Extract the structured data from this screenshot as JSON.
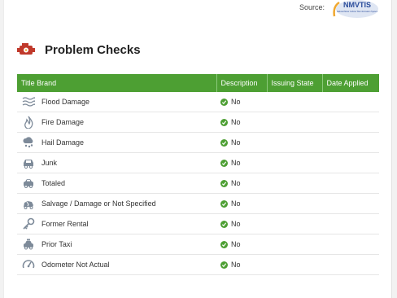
{
  "source": {
    "label": "Source:",
    "logo_text": "NMVTIS",
    "logo_subtext": "National Motor Vehicle Title Information System"
  },
  "section": {
    "title": "Problem Checks"
  },
  "table": {
    "headers": [
      "Title Brand",
      "Description",
      "Issuing State",
      "Date Applied"
    ],
    "rows": [
      {
        "brand": "Flood Damage",
        "icon": "flood-icon",
        "description": "No",
        "issuing_state": "",
        "date_applied": ""
      },
      {
        "brand": "Fire Damage",
        "icon": "fire-icon",
        "description": "No",
        "issuing_state": "",
        "date_applied": ""
      },
      {
        "brand": "Hail Damage",
        "icon": "hail-icon",
        "description": "No",
        "issuing_state": "",
        "date_applied": ""
      },
      {
        "brand": "Junk",
        "icon": "junk-car-icon",
        "description": "No",
        "issuing_state": "",
        "date_applied": ""
      },
      {
        "brand": "Totaled",
        "icon": "totaled-car-icon",
        "description": "No",
        "issuing_state": "",
        "date_applied": ""
      },
      {
        "brand": "Salvage / Damage or Not Specified",
        "icon": "salvage-icon",
        "description": "No",
        "issuing_state": "",
        "date_applied": ""
      },
      {
        "brand": "Former Rental",
        "icon": "key-icon",
        "description": "No",
        "issuing_state": "",
        "date_applied": ""
      },
      {
        "brand": "Prior Taxi",
        "icon": "taxi-icon",
        "description": "No",
        "issuing_state": "",
        "date_applied": ""
      },
      {
        "brand": "Odometer Not Actual",
        "icon": "odometer-icon",
        "description": "No",
        "issuing_state": "",
        "date_applied": ""
      }
    ]
  },
  "colors": {
    "header_bg": "#4d9f33",
    "check": "#4d9f33",
    "icon": "#7d8a99"
  }
}
